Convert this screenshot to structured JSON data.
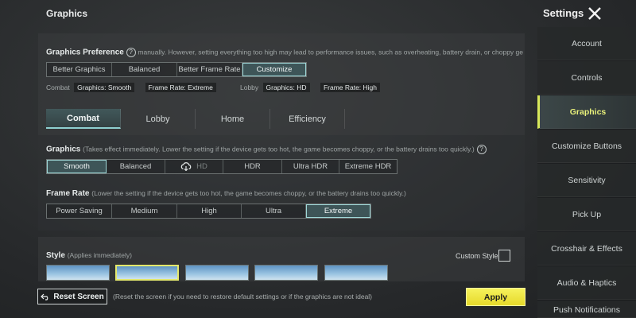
{
  "header": {
    "page_title": "Graphics",
    "settings_title": "Settings"
  },
  "sidebar": {
    "items": [
      {
        "label": "Account",
        "active": false
      },
      {
        "label": "Controls",
        "active": false
      },
      {
        "label": "Graphics",
        "active": true
      },
      {
        "label": "Customize Buttons",
        "active": false
      },
      {
        "label": "Sensitivity",
        "active": false
      },
      {
        "label": "Pick Up",
        "active": false
      },
      {
        "label": "Crosshair & Effects",
        "active": false
      },
      {
        "label": "Audio & Haptics",
        "active": false
      },
      {
        "label": "Push Notifications",
        "active": false
      }
    ]
  },
  "preference": {
    "label": "Graphics Preference",
    "hint": "manually. However, setting everything too high may lead to performance issues, such as overheating, battery drain, or choppy ge",
    "options": [
      "Better Graphics",
      "Balanced",
      "Better Frame Rate",
      "Customize"
    ],
    "selected": "Customize",
    "combat_label": "Combat",
    "combat_graphics": "Graphics: Smooth",
    "combat_framerate": "Frame Rate: Extreme",
    "lobby_label": "Lobby",
    "lobby_graphics": "Graphics: HD",
    "lobby_framerate": "Frame Rate: High"
  },
  "tabs": [
    "Combat",
    "Lobby",
    "Home",
    "Efficiency"
  ],
  "active_tab": "Combat",
  "graphics": {
    "label": "Graphics",
    "hint": "(Takes effect immediately. Lower the setting if the device gets too hot, the game becomes choppy, or the battery drains too quickly.)",
    "options": [
      "Smooth",
      "Balanced",
      "HD",
      "HDR",
      "Ultra HDR",
      "Extreme HDR"
    ],
    "selected": "Smooth"
  },
  "framerate": {
    "label": "Frame Rate",
    "hint": "(Lower the setting if the device gets too hot, the game becomes choppy, or the battery drains too quickly.)",
    "options": [
      "Power Saving",
      "Medium",
      "High",
      "Ultra",
      "Extreme"
    ],
    "selected": "Extreme"
  },
  "style": {
    "label": "Style",
    "hint": "(Applies immediately)",
    "custom_label": "Custom Style"
  },
  "footer": {
    "reset_label": "Reset Screen",
    "reset_note": "(Reset the screen if you need to restore default settings or if the graphics are not ideal)",
    "apply_label": "Apply"
  },
  "colors": {
    "accent": "#8ed0d0",
    "apply": "#f0e840",
    "active_side": "#e8f07a"
  }
}
